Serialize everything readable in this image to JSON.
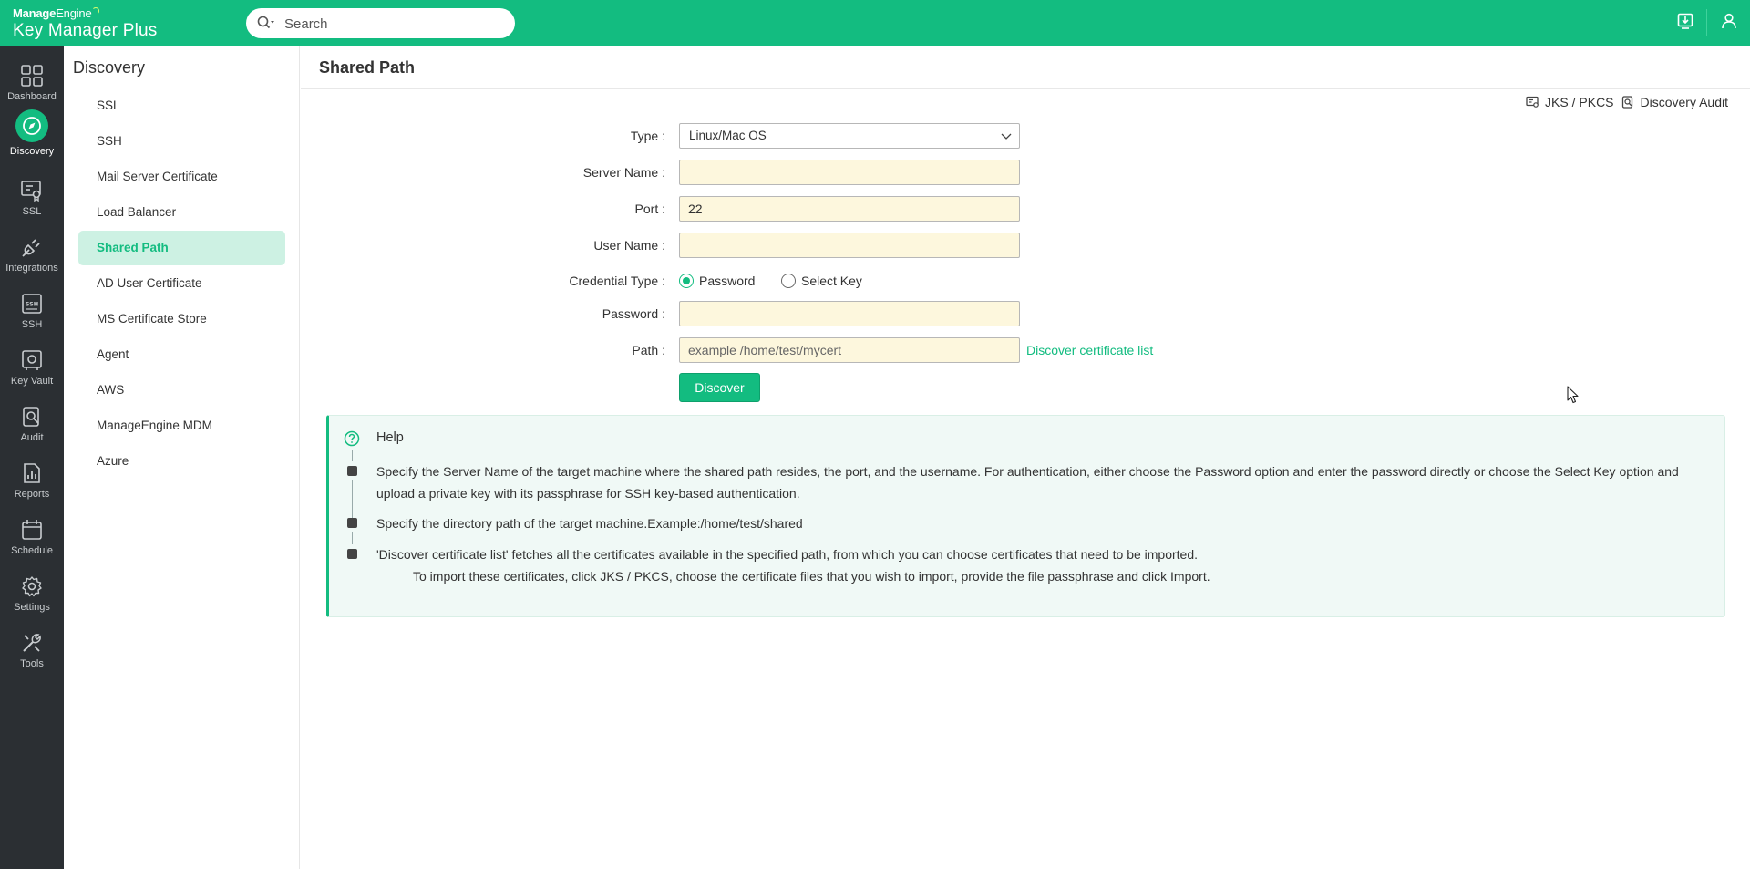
{
  "app": {
    "brand_top_bold": "Manage",
    "brand_top_light": "Engine",
    "brand_bottom_bold": "Key Manager",
    "brand_bottom_light": "Plus"
  },
  "search": {
    "placeholder": "Search"
  },
  "leftnav": [
    {
      "label": "Dashboard",
      "icon": "dashboard-icon"
    },
    {
      "label": "Discovery",
      "icon": "compass-icon",
      "active": true
    },
    {
      "label": "SSL",
      "icon": "ssl-certificate-icon"
    },
    {
      "label": "Integrations",
      "icon": "plug-icon"
    },
    {
      "label": "SSH",
      "icon": "ssh-icon"
    },
    {
      "label": "Key Vault",
      "icon": "vault-icon"
    },
    {
      "label": "Audit",
      "icon": "audit-icon"
    },
    {
      "label": "Reports",
      "icon": "reports-icon"
    },
    {
      "label": "Schedule",
      "icon": "calendar-icon"
    },
    {
      "label": "Settings",
      "icon": "gear-icon"
    },
    {
      "label": "Tools",
      "icon": "tools-icon"
    }
  ],
  "subnav": {
    "title": "Discovery",
    "items": [
      "SSL",
      "SSH",
      "Mail Server Certificate",
      "Load Balancer",
      "Shared Path",
      "AD User Certificate",
      "MS Certificate Store",
      "Agent",
      "AWS",
      "ManageEngine MDM",
      "Azure"
    ],
    "active": "Shared Path"
  },
  "page": {
    "title": "Shared Path",
    "links": {
      "jks": "JKS / PKCS",
      "audit": "Discovery Audit"
    }
  },
  "form": {
    "type_label": "Type :",
    "type_value": "Linux/Mac OS",
    "server_label": "Server Name :",
    "server_value": "",
    "port_label": "Port :",
    "port_value": "22",
    "user_label": "User Name :",
    "user_value": "",
    "cred_label": "Credential Type :",
    "cred_password": "Password",
    "cred_key": "Select Key",
    "password_label": "Password :",
    "password_value": "",
    "path_label": "Path :",
    "path_placeholder": "example /home/test/mycert",
    "discover_link": "Discover certificate list",
    "discover_button": "Discover"
  },
  "help": {
    "title": "Help",
    "item1": "Specify the Server Name of the target machine where the shared path resides, the port, and the username. For authentication, either choose the Password option and enter the password directly or choose the Select Key option and upload a private key with its passphrase for SSH key-based authentication.",
    "item2": "Specify the directory path of the target machine.Example:/home/test/shared",
    "item3a": "'Discover certificate list' fetches all the certificates available in the specified path, from which you can choose certificates that need to be imported.",
    "item3b": "To import these certificates, click JKS / PKCS, choose the certificate files that you wish to import, provide the file passphrase and click Import."
  }
}
